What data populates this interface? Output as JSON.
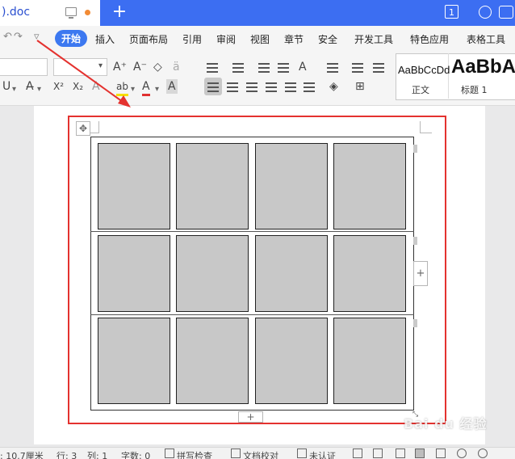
{
  "titlebar": {
    "doc_tab_title": ").doc",
    "new_tab_symbol": "+",
    "window_count": "1"
  },
  "quick_access": {
    "undo_symbol": "↶",
    "redo_symbol": "↷",
    "customize_symbol": "▿"
  },
  "menu": {
    "items": [
      "开始",
      "插入",
      "页面布局",
      "引用",
      "审阅",
      "视图",
      "章节",
      "安全",
      "开发工具",
      "特色应用",
      "表格工具"
    ],
    "active_index": 0
  },
  "ribbon": {
    "style_samples": [
      {
        "sample": "AaBbCcDd",
        "label": "正文"
      },
      {
        "sample": "AaBbA",
        "label": "标题 1"
      }
    ]
  },
  "table": {
    "rows": 3,
    "cols": 4,
    "cell_fill": "#c8c8c8",
    "add_row_symbol": "+",
    "add_col_symbol": "+",
    "move_symbol": "✥"
  },
  "highlight_color": "#e4322f",
  "statusbar": {
    "position": ": 10.7厘米",
    "row": "行: 3",
    "col": "列: 1",
    "word_count": "字数: 0",
    "spell_check": "拼写检查",
    "doc_proof": "文档校对",
    "track_changes": "未认证"
  },
  "watermark_text": "Bai du 经验"
}
